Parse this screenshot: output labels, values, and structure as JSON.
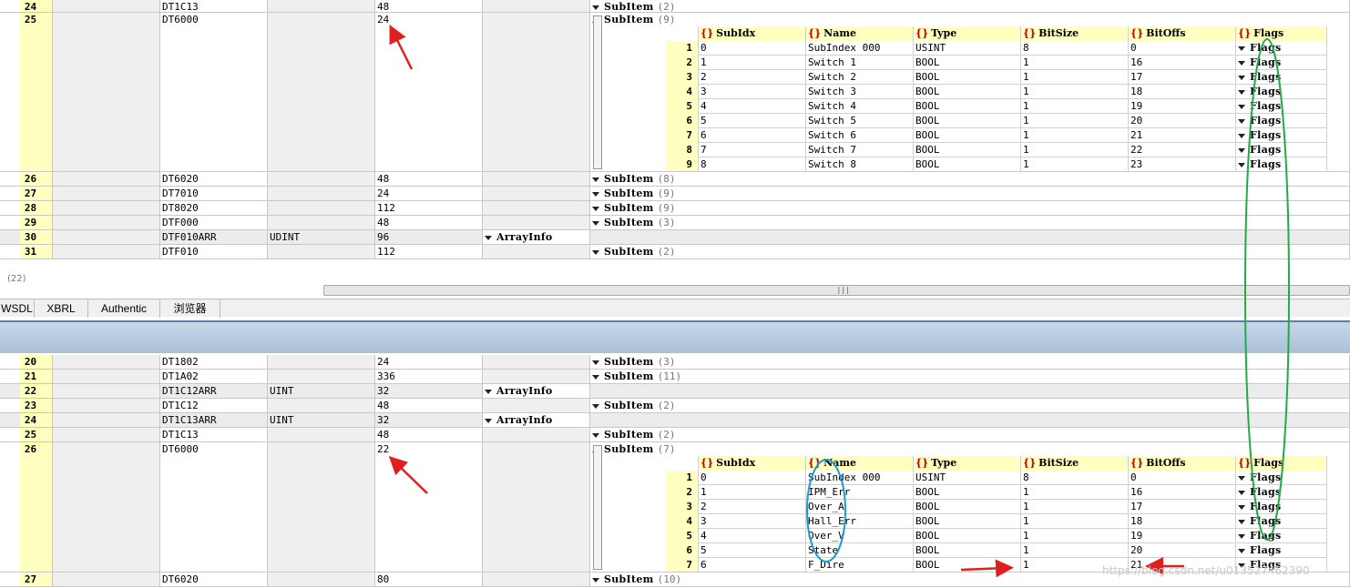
{
  "top_rows": [
    {
      "num": "24",
      "name": "DT1C13",
      "type": "",
      "size": "48",
      "arrayinfo": "",
      "subitem": "SubItem",
      "count": "(2)"
    },
    {
      "num": "25",
      "name": "DT6000",
      "type": "",
      "size": "24",
      "arrayinfo": "",
      "subitem": "SubItem",
      "count": "(9)"
    },
    {
      "num": "26",
      "name": "DT6020",
      "type": "",
      "size": "48",
      "arrayinfo": "",
      "subitem": "SubItem",
      "count": "(8)"
    },
    {
      "num": "27",
      "name": "DT7010",
      "type": "",
      "size": "24",
      "arrayinfo": "",
      "subitem": "SubItem",
      "count": "(9)"
    },
    {
      "num": "28",
      "name": "DT8020",
      "type": "",
      "size": "112",
      "arrayinfo": "",
      "subitem": "SubItem",
      "count": "(9)"
    },
    {
      "num": "29",
      "name": "DTF000",
      "type": "",
      "size": "48",
      "arrayinfo": "",
      "subitem": "SubItem",
      "count": "(3)"
    },
    {
      "num": "30",
      "name": "DTF010ARR",
      "type": "UDINT",
      "size": "96",
      "arrayinfo": "ArrayInfo",
      "subitem": "",
      "count": ""
    },
    {
      "num": "31",
      "name": "DTF010",
      "type": "",
      "size": "112",
      "arrayinfo": "",
      "subitem": "SubItem",
      "count": "(2)"
    }
  ],
  "top_nested": {
    "headers": [
      "SubIdx",
      "Name",
      "Type",
      "BitSize",
      "BitOffs",
      "Flags"
    ],
    "rows": [
      {
        "i": "1",
        "subidx": "0",
        "name": "SubIndex 000",
        "type": "USINT",
        "bitsize": "8",
        "bitoffs": "0",
        "flags": "Flags"
      },
      {
        "i": "2",
        "subidx": "1",
        "name": "Switch 1",
        "type": "BOOL",
        "bitsize": "1",
        "bitoffs": "16",
        "flags": "Flags"
      },
      {
        "i": "3",
        "subidx": "2",
        "name": "Switch 2",
        "type": "BOOL",
        "bitsize": "1",
        "bitoffs": "17",
        "flags": "Flags"
      },
      {
        "i": "4",
        "subidx": "3",
        "name": "Switch 3",
        "type": "BOOL",
        "bitsize": "1",
        "bitoffs": "18",
        "flags": "Flags"
      },
      {
        "i": "5",
        "subidx": "4",
        "name": "Switch 4",
        "type": "BOOL",
        "bitsize": "1",
        "bitoffs": "19",
        "flags": "Flags"
      },
      {
        "i": "6",
        "subidx": "5",
        "name": "Switch 5",
        "type": "BOOL",
        "bitsize": "1",
        "bitoffs": "20",
        "flags": "Flags"
      },
      {
        "i": "7",
        "subidx": "6",
        "name": "Switch 6",
        "type": "BOOL",
        "bitsize": "1",
        "bitoffs": "21",
        "flags": "Flags"
      },
      {
        "i": "8",
        "subidx": "7",
        "name": "Switch 7",
        "type": "BOOL",
        "bitsize": "1",
        "bitoffs": "22",
        "flags": "Flags"
      },
      {
        "i": "9",
        "subidx": "8",
        "name": "Switch 8",
        "type": "BOOL",
        "bitsize": "1",
        "bitoffs": "23",
        "flags": "Flags"
      }
    ]
  },
  "status_text": "(22)",
  "tabs": [
    "WSDL",
    "XBRL",
    "Authentic",
    "浏览器"
  ],
  "bottom_rows": [
    {
      "num": "20",
      "name": "DT1802",
      "type": "",
      "size": "24",
      "arrayinfo": "",
      "subitem": "SubItem",
      "count": "(3)"
    },
    {
      "num": "21",
      "name": "DT1A02",
      "type": "",
      "size": "336",
      "arrayinfo": "",
      "subitem": "SubItem",
      "count": "(11)"
    },
    {
      "num": "22",
      "name": "DT1C12ARR",
      "type": "UINT",
      "size": "32",
      "arrayinfo": "ArrayInfo",
      "subitem": "",
      "count": ""
    },
    {
      "num": "23",
      "name": "DT1C12",
      "type": "",
      "size": "48",
      "arrayinfo": "",
      "subitem": "SubItem",
      "count": "(2)"
    },
    {
      "num": "24",
      "name": "DT1C13ARR",
      "type": "UINT",
      "size": "32",
      "arrayinfo": "ArrayInfo",
      "subitem": "",
      "count": ""
    },
    {
      "num": "25",
      "name": "DT1C13",
      "type": "",
      "size": "48",
      "arrayinfo": "",
      "subitem": "SubItem",
      "count": "(2)"
    },
    {
      "num": "26",
      "name": "DT6000",
      "type": "",
      "size": "22",
      "arrayinfo": "",
      "subitem": "SubItem",
      "count": "(7)"
    },
    {
      "num": "27",
      "name": "DT6020",
      "type": "",
      "size": "80",
      "arrayinfo": "",
      "subitem": "SubItem",
      "count": "(10)"
    }
  ],
  "bottom_nested": {
    "headers": [
      "SubIdx",
      "Name",
      "Type",
      "BitSize",
      "BitOffs",
      "Flags"
    ],
    "rows": [
      {
        "i": "1",
        "subidx": "0",
        "name": "SubIndex 000",
        "type": "USINT",
        "bitsize": "8",
        "bitoffs": "0",
        "flags": "Flags"
      },
      {
        "i": "2",
        "subidx": "1",
        "name": "IPM_Err",
        "type": "BOOL",
        "bitsize": "1",
        "bitoffs": "16",
        "flags": "Flags"
      },
      {
        "i": "3",
        "subidx": "2",
        "name": "Over_A",
        "type": "BOOL",
        "bitsize": "1",
        "bitoffs": "17",
        "flags": "Flags"
      },
      {
        "i": "4",
        "subidx": "3",
        "name": "Hall_Err",
        "type": "BOOL",
        "bitsize": "1",
        "bitoffs": "18",
        "flags": "Flags"
      },
      {
        "i": "5",
        "subidx": "4",
        "name": "Over_V",
        "type": "BOOL",
        "bitsize": "1",
        "bitoffs": "19",
        "flags": "Flags"
      },
      {
        "i": "6",
        "subidx": "5",
        "name": "State",
        "type": "BOOL",
        "bitsize": "1",
        "bitoffs": "20",
        "flags": "Flags"
      },
      {
        "i": "7",
        "subidx": "6",
        "name": "F_Dire",
        "type": "BOOL",
        "bitsize": "1",
        "bitoffs": "21",
        "flags": "Flags"
      }
    ]
  },
  "watermark": "https://blog.csdn.net/u013527462390",
  "colors": {
    "annotation_arrow": "#e02020",
    "annotation_green": "#22aa44",
    "annotation_blue": "#1a9ad6",
    "row_header": "#ffffc0"
  }
}
